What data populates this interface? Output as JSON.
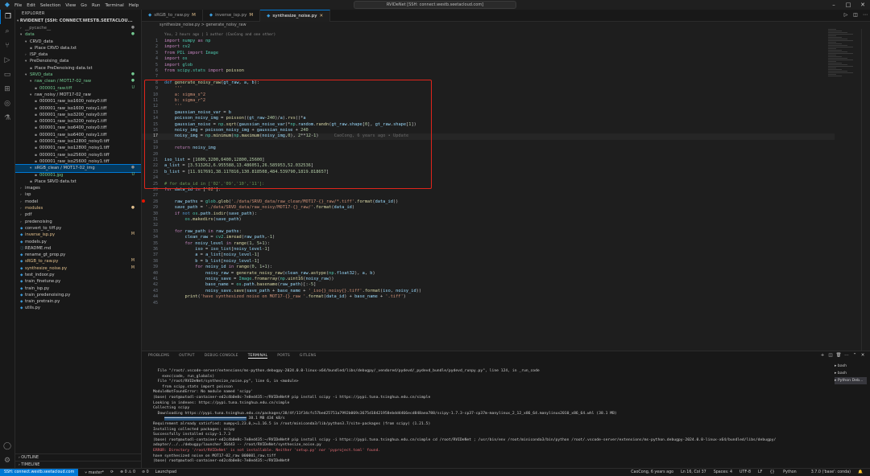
{
  "titlebar": {
    "menu": [
      "File",
      "Edit",
      "Selection",
      "View",
      "Go",
      "Run",
      "Terminal",
      "Help"
    ],
    "search": "RVIDeNet [SSH: connect.westb.seetacloud.com]"
  },
  "sidebar": {
    "header": "EXPLORER",
    "root": "RVIDENET [SSH: CONNECT.WESTB.SEETACLOU...",
    "items": [
      {
        "label": "__pycache__",
        "indent": 1,
        "kind": "folder",
        "open": false,
        "cls": "c-dim",
        "badge": "●"
      },
      {
        "label": "data",
        "indent": 1,
        "kind": "folder",
        "open": true,
        "cls": "c-untracked",
        "badge": "●"
      },
      {
        "label": "CRVD_data",
        "indent": 2,
        "kind": "folder",
        "open": true,
        "cls": "",
        "badge": ""
      },
      {
        "label": "Place CRVD data.txt",
        "indent": 3,
        "kind": "file",
        "cls": "",
        "badge": ""
      },
      {
        "label": "ISP_data",
        "indent": 2,
        "kind": "folder",
        "open": false,
        "cls": "",
        "badge": ""
      },
      {
        "label": "PreDenoising_data",
        "indent": 2,
        "kind": "folder",
        "open": true,
        "cls": "",
        "badge": ""
      },
      {
        "label": "Place PreDenoising data.txt",
        "indent": 3,
        "kind": "file",
        "cls": "",
        "badge": ""
      },
      {
        "label": "SRVD_data",
        "indent": 2,
        "kind": "folder",
        "open": true,
        "cls": "c-untracked",
        "badge": "●"
      },
      {
        "label": "raw_clean / MOT17-02_raw",
        "indent": 3,
        "kind": "folder",
        "open": true,
        "cls": "c-untracked",
        "badge": "●"
      },
      {
        "label": "000001_raw.tiff",
        "indent": 4,
        "kind": "file",
        "cls": "c-untracked",
        "badge": "U"
      },
      {
        "label": "raw_noisy / MOT17-02_raw",
        "indent": 3,
        "kind": "folder",
        "open": true,
        "cls": "",
        "badge": ""
      },
      {
        "label": "000001_raw_iso1600_noisy0.tiff",
        "indent": 4,
        "kind": "file",
        "cls": "",
        "badge": ""
      },
      {
        "label": "000001_raw_iso1600_noisy1.tiff",
        "indent": 4,
        "kind": "file",
        "cls": "",
        "badge": ""
      },
      {
        "label": "000001_raw_iso3200_noisy0.tiff",
        "indent": 4,
        "kind": "file",
        "cls": "",
        "badge": ""
      },
      {
        "label": "000001_raw_iso3200_noisy1.tiff",
        "indent": 4,
        "kind": "file",
        "cls": "",
        "badge": ""
      },
      {
        "label": "000001_raw_iso6400_noisy0.tiff",
        "indent": 4,
        "kind": "file",
        "cls": "",
        "badge": ""
      },
      {
        "label": "000001_raw_iso6400_noisy1.tiff",
        "indent": 4,
        "kind": "file",
        "cls": "",
        "badge": ""
      },
      {
        "label": "000001_raw_iso12800_noisy0.tiff",
        "indent": 4,
        "kind": "file",
        "cls": "",
        "badge": ""
      },
      {
        "label": "000001_raw_iso12800_noisy1.tiff",
        "indent": 4,
        "kind": "file",
        "cls": "",
        "badge": ""
      },
      {
        "label": "000001_raw_iso25600_noisy0.tiff",
        "indent": 4,
        "kind": "file",
        "cls": "",
        "badge": ""
      },
      {
        "label": "000001_raw_iso25600_noisy1.tiff",
        "indent": 4,
        "kind": "file",
        "cls": "",
        "badge": ""
      },
      {
        "label": "sRGB_clean / MOT17-02_img",
        "indent": 3,
        "kind": "folder",
        "open": true,
        "cls": "",
        "badge": "●",
        "sel": true
      },
      {
        "label": "000001.jpg",
        "indent": 4,
        "kind": "file",
        "cls": "c-untracked",
        "badge": "U"
      },
      {
        "label": "Place SRVD data.txt",
        "indent": 3,
        "kind": "file",
        "cls": "",
        "badge": ""
      },
      {
        "label": "images",
        "indent": 1,
        "kind": "folder",
        "open": false,
        "cls": "",
        "badge": ""
      },
      {
        "label": "isp",
        "indent": 1,
        "kind": "folder",
        "open": false,
        "cls": "",
        "badge": ""
      },
      {
        "label": "model",
        "indent": 1,
        "kind": "folder",
        "open": false,
        "cls": "",
        "badge": ""
      },
      {
        "label": "modules",
        "indent": 1,
        "kind": "folder",
        "open": false,
        "cls": "c-mod",
        "badge": "●"
      },
      {
        "label": "pdf",
        "indent": 1,
        "kind": "folder",
        "open": false,
        "cls": "",
        "badge": ""
      },
      {
        "label": "predenoising",
        "indent": 1,
        "kind": "folder",
        "open": false,
        "cls": "",
        "badge": ""
      },
      {
        "label": "convert_to_tiff.py",
        "indent": 1,
        "kind": "py",
        "cls": "",
        "badge": ""
      },
      {
        "label": "inverse_isp.py",
        "indent": 1,
        "kind": "py",
        "cls": "c-mod",
        "badge": "M"
      },
      {
        "label": "models.py",
        "indent": 1,
        "kind": "py",
        "cls": "",
        "badge": ""
      },
      {
        "label": "README.md",
        "indent": 1,
        "kind": "md",
        "cls": "",
        "badge": ""
      },
      {
        "label": "rename_gt_prop.py",
        "indent": 1,
        "kind": "py",
        "cls": "",
        "badge": ""
      },
      {
        "label": "sRGB_to_raw.py",
        "indent": 1,
        "kind": "py",
        "cls": "c-mod",
        "badge": "M"
      },
      {
        "label": "synthesize_noise.py",
        "indent": 1,
        "kind": "py",
        "cls": "c-mod",
        "badge": "M"
      },
      {
        "label": "test_indoor.py",
        "indent": 1,
        "kind": "py",
        "cls": "",
        "badge": ""
      },
      {
        "label": "train_finetune.py",
        "indent": 1,
        "kind": "py",
        "cls": "",
        "badge": ""
      },
      {
        "label": "train_isp.py",
        "indent": 1,
        "kind": "py",
        "cls": "",
        "badge": ""
      },
      {
        "label": "train_predenoising.py",
        "indent": 1,
        "kind": "py",
        "cls": "",
        "badge": ""
      },
      {
        "label": "train_pretrain.py",
        "indent": 1,
        "kind": "py",
        "cls": "",
        "badge": ""
      },
      {
        "label": "utils.py",
        "indent": 1,
        "kind": "py",
        "cls": "",
        "badge": ""
      }
    ],
    "outline": "OUTLINE",
    "timeline": "TIMELINE"
  },
  "tabs": [
    {
      "label": "sRGB_to_raw.py",
      "mod": "M",
      "active": false
    },
    {
      "label": "inverse_isp.py",
      "mod": "M",
      "active": false
    },
    {
      "label": "synthesize_noise.py",
      "mod": "M",
      "active": true
    }
  ],
  "breadcrumb": "synthesize_noise.py  >  generate_noisy_raw",
  "editor": {
    "lens": "You, 2 hours ago | 1 author (CaoCong and one other)",
    "blame": "CaoCong, 6 years ago • Update",
    "lines": [
      {
        "n": "1",
        "html": "<span class=\"kw\">import</span> <span class=\"cls\">numpy</span> <span class=\"kw\">as</span> <span class=\"cls\">np</span>"
      },
      {
        "n": "2",
        "html": "<span class=\"kw\">import</span> <span class=\"cls\">cv2</span>"
      },
      {
        "n": "3",
        "html": "<span class=\"kw\">from</span> <span class=\"cls\">PIL</span> <span class=\"kw\">import</span> <span class=\"cls\">Image</span>"
      },
      {
        "n": "4",
        "html": "<span class=\"kw\">import</span> <span class=\"cls\">os</span>"
      },
      {
        "n": "5",
        "html": "<span class=\"kw\">import</span> <span class=\"cls\">glob</span>"
      },
      {
        "n": "6",
        "html": "<span class=\"kw\">from</span> <span class=\"cls\">scipy.stats</span> <span class=\"kw\">import</span> <span class=\"fn\">poisson</span>"
      },
      {
        "n": "7",
        "html": ""
      },
      {
        "n": "8",
        "html": "<span class=\"kw2\">def</span> <span class=\"fn\">generate_noisy_raw</span>(<span class=\"var\">gt_raw</span>, <span class=\"var\">a</span>, <span class=\"var\">b</span>):"
      },
      {
        "n": "9",
        "html": "    <span class=\"str\">'''</span>"
      },
      {
        "n": "10",
        "html": "<span class=\"str\">    a: sigma_s^2</span>"
      },
      {
        "n": "11",
        "html": "<span class=\"str\">    b: sigma_r^2</span>"
      },
      {
        "n": "12",
        "html": "<span class=\"str\">    '''</span>"
      },
      {
        "n": "13",
        "html": "    <span class=\"var\">gaussian_noise_var</span> = <span class=\"var\">b</span>"
      },
      {
        "n": "14",
        "html": "    <span class=\"var\">poisson_noisy_img</span> = <span class=\"fn\">poisson</span>((<span class=\"var\">gt_raw</span>-<span class=\"num\">240</span>)/<span class=\"var\">a</span>).<span class=\"fn\">rvs</span>()*<span class=\"var\">a</span>"
      },
      {
        "n": "15",
        "html": "    <span class=\"var\">gaussian_noise</span> = <span class=\"cls\">np</span>.<span class=\"fn\">sqrt</span>(<span class=\"var\">gaussian_noise_var</span>)*<span class=\"cls\">np</span>.<span class=\"var\">random</span>.<span class=\"fn\">randn</span>(<span class=\"var\">gt_raw</span>.<span class=\"var\">shape</span>[<span class=\"num\">0</span>], <span class=\"var\">gt_raw</span>.<span class=\"var\">shape</span>[<span class=\"num\">1</span>])"
      },
      {
        "n": "16",
        "html": "    <span class=\"var\">noisy_img</span> = <span class=\"var\">poisson_noisy_img</span> + <span class=\"var\">gaussian_noise</span> + <span class=\"num\">240</span>"
      },
      {
        "n": "17",
        "html": "    <span class=\"var\">noisy_img</span> = <span class=\"cls\">np</span>.<span class=\"fn\">minimum</span>(<span class=\"cls\">np</span>.<span class=\"fn\">maximum</span>(<span class=\"var\">noisy_img</span>,<span class=\"num\">0</span>), <span class=\"num\">2</span>**<span class=\"num\">12</span>-<span class=\"num\">1</span>)",
        "cur": true
      },
      {
        "n": "18",
        "html": ""
      },
      {
        "n": "19",
        "html": "    <span class=\"kw\">return</span> <span class=\"var\">noisy_img</span>"
      },
      {
        "n": "20",
        "html": ""
      },
      {
        "n": "21",
        "html": "<span class=\"var\">iso_list</span> = [<span class=\"num\">1600</span>,<span class=\"num\">3200</span>,<span class=\"num\">6400</span>,<span class=\"num\">12800</span>,<span class=\"num\">25600</span>]"
      },
      {
        "n": "22",
        "html": "<span class=\"var\">a_list</span> = [<span class=\"num\">3.513262</span>,<span class=\"num\">6.955588</span>,<span class=\"num\">13.486051</span>,<span class=\"num\">26.585953</span>,<span class=\"num\">52.032536</span>]"
      },
      {
        "n": "23",
        "html": "<span class=\"var\">b_list</span> = [<span class=\"num\">11.917691</span>,<span class=\"num\">38.117816</span>,<span class=\"num\">130.818508</span>,<span class=\"num\">484.539790</span>,<span class=\"num\">1819.818657</span>]"
      },
      {
        "n": "24",
        "html": ""
      },
      {
        "n": "25",
        "html": "<span class=\"cm\"># for data_id in ['02','09','10','11']:</span>"
      },
      {
        "n": "26",
        "html": "<span class=\"kw\">for</span> <span class=\"var\">data_id</span> <span class=\"kw\">in</span> [<span class=\"str\">'02'</span>]:"
      },
      {
        "n": "27",
        "html": ""
      },
      {
        "n": "28",
        "html": "    <span class=\"var\">raw_paths</span> = <span class=\"cls\">glob</span>.<span class=\"fn\">glob</span>(<span class=\"str\">'./data/SRVD_data/raw_clean/MOT17-{}_raw/*.tiff'</span>.<span class=\"fn\">format</span>(<span class=\"var\">data_id</span>))"
      },
      {
        "n": "29",
        "html": "    <span class=\"var\">save_path</span> = <span class=\"str\">'./data/SRVD_data/raw_noisy/MOT17-{}_raw/'</span>.<span class=\"fn\">format</span>(<span class=\"var\">data_id</span>)"
      },
      {
        "n": "30",
        "html": "    <span class=\"kw\">if</span> <span class=\"kw2\">not</span> <span class=\"cls\">os</span>.<span class=\"var\">path</span>.<span class=\"fn\">isdir</span>(<span class=\"var\">save_path</span>):"
      },
      {
        "n": "31",
        "html": "        <span class=\"cls\">os</span>.<span class=\"fn\">makedirs</span>(<span class=\"var\">save_path</span>)"
      },
      {
        "n": "32",
        "html": ""
      },
      {
        "n": "33",
        "html": "    <span class=\"kw\">for</span> <span class=\"var\">raw_path</span> <span class=\"kw\">in</span> <span class=\"var\">raw_paths</span>:"
      },
      {
        "n": "34",
        "html": "        <span class=\"var\">clean_raw</span> = <span class=\"cls\">cv2</span>.<span class=\"fn\">imread</span>(<span class=\"var\">raw_path</span>,<span class=\"num\">-1</span>)"
      },
      {
        "n": "35",
        "html": "        <span class=\"kw\">for</span> <span class=\"var\">noisy_level</span> <span class=\"kw\">in</span> <span class=\"fn\">range</span>(<span class=\"num\">1</span>, <span class=\"num\">5</span>+<span class=\"num\">1</span>):"
      },
      {
        "n": "36",
        "html": "            <span class=\"var\">iso</span> = <span class=\"var\">iso_list</span>[<span class=\"var\">noisy_level</span>-<span class=\"num\">1</span>]"
      },
      {
        "n": "37",
        "html": "            <span class=\"var\">a</span> = <span class=\"var\">a_list</span>[<span class=\"var\">noisy_level</span>-<span class=\"num\">1</span>]"
      },
      {
        "n": "38",
        "html": "            <span class=\"var\">b</span> = <span class=\"var\">b_list</span>[<span class=\"var\">noisy_level</span>-<span class=\"num\">1</span>]"
      },
      {
        "n": "39",
        "html": "            <span class=\"kw\">for</span> <span class=\"var\">noisy_id</span> <span class=\"kw\">in</span> <span class=\"fn\">range</span>(<span class=\"num\">0</span>, <span class=\"num\">1</span>+<span class=\"num\">1</span>):"
      },
      {
        "n": "40",
        "html": "                <span class=\"var\">noisy_raw</span> = <span class=\"fn\">generate_noisy_raw</span>(<span class=\"var\">clean_raw</span>.<span class=\"fn\">astype</span>(<span class=\"cls\">np</span>.<span class=\"var\">float32</span>), <span class=\"var\">a</span>, <span class=\"var\">b</span>)"
      },
      {
        "n": "41",
        "html": "                <span class=\"var\">noisy_save</span> = <span class=\"cls\">Image</span>.<span class=\"fn\">fromarray</span>(<span class=\"cls\">np</span>.<span class=\"fn\">uint16</span>(<span class=\"var\">noisy_raw</span>))"
      },
      {
        "n": "42",
        "html": "                <span class=\"var\">base_name</span> = <span class=\"cls\">os</span>.<span class=\"var\">path</span>.<span class=\"fn\">basename</span>(<span class=\"var\">raw_path</span>)[:<span class=\"num\">-5</span>]"
      },
      {
        "n": "43",
        "html": "                <span class=\"var\">noisy_save</span>.<span class=\"fn\">save</span>(<span class=\"var\">save_path</span> + <span class=\"var\">base_name</span> + <span class=\"str\">'_iso{}_noisy{}.tiff'</span>.<span class=\"fn\">format</span>(<span class=\"var\">iso</span>, <span class=\"var\">noisy_id</span>))"
      },
      {
        "n": "44",
        "html": "        <span class=\"fn\">print</span>(<span class=\"str\">'have synthesized noise on MOT17-{}_raw '</span>.<span class=\"fn\">format</span>(<span class=\"var\">data_id</span>) + <span class=\"var\">base_name</span> + <span class=\"str\">'.tiff'</span>)"
      },
      {
        "n": "45",
        "html": ""
      }
    ]
  },
  "panel": {
    "tabs": [
      "PROBLEMS",
      "OUTPUT",
      "DEBUG CONSOLE",
      "TERMINAL",
      "PORTS",
      "GITLENS"
    ],
    "active_tab": "TERMINAL",
    "terminals": [
      "bash",
      "bash",
      "Python Deb..."
    ],
    "lines": [
      {
        "t": "  File \"/root/.vscode-server/extensions/ms-python.debugpy-2024.0.0-linux-x64/bundled/libs/debugpy/_vendored/pydevd/_pydevd_bundle/pydevd_runpy.py\", line 124, in _run_code"
      },
      {
        "t": "    exec(code, run_globals)"
      },
      {
        "t": "  File \"/root/RVIDeNet/synthesize_noise.py\", line 6, in <module>"
      },
      {
        "t": "    from scipy.stats import poisson"
      },
      {
        "t": "ModuleNotFoundError: No module named 'scipy'"
      },
      {
        "t": "(base) root@autodl-container-ed2c4b0e8c-7e8ed435:~/RVIDeNet# pip install scipy -i https://pypi.tuna.tsinghua.edu.cn/simple"
      },
      {
        "t": "Looking in indexes: https://pypi.tuna.tsinghua.edu.cn/simple"
      },
      {
        "t": "Collecting scipy"
      },
      {
        "t": "  Downloading https://pypi.tuna.tsinghua.edu.cn/packages/38/4f/11f34cfc57bed25751a7992b069c3675d18421958ebdd4466ecd848aea788/scipy-1.7.3-cp37-cp37m-manylinux_2_12_x86_64.manylinux2010_x86_64.whl (38.1 MB)"
      },
      {
        "t": "     ",
        "sel": "━━━━━━━━━━━━━━━━━━━━━━━━━━━━━━━━━━━━",
        "post": " 38.1 MB 434 kB/s"
      },
      {
        "t": "Requirement already satisfied: numpy<1.23.0,>=1.16.5 in /root/miniconda3/lib/python3.7/site-packages (from scipy) (1.21.5)"
      },
      {
        "t": "Installing collected packages: scipy"
      },
      {
        "t": "Successfully installed scipy-1.7.3"
      },
      {
        "t": "(base) root@autodl-container-ed2c4b0e8c-7e8ed435:~/RVIDeNet# pip install scipy -i https://pypi.tuna.tsinghua.edu.cn/simple cd /root/RVIDeNet ; /usr/bin/env /root/miniconda3/bin/python /root/.vscode-server/extensions/ms-python.debugpy-2024.0.0-linux-x64/bundled/libs/debugpy/"
      },
      {
        "t": "adapter/../../debugpy/launcher 56443 -- /root/RVIDeNet/synthesize_noise.py"
      },
      {
        "t": "ERROR: Directory '/root/RVIDeNet' is not installable. Neither 'setup.py' nor 'pyproject.toml' found.",
        "err": true
      },
      {
        "t": "have synthesized noise on MOT17-02_raw 000001_raw.tiff"
      },
      {
        "t": "(base) root@autodl-container-ed2c4b0e8c-7e8ed435:~/RVIDeNet# "
      }
    ]
  },
  "statusbar": {
    "remote": "SSH: connect.westb.seetacloud.com",
    "branch": "master*",
    "sync": "⟳",
    "problems": "⊗ 0 ⚠ 0",
    "ports": "⊘ 0",
    "launch": "Launchpad",
    "blame": "CaoCong, 6 years ago",
    "position": "Ln 16, Col 37",
    "spaces": "Spaces: 4",
    "encoding": "UTF-8",
    "eol": "LF",
    "language": "Python",
    "interpreter": "3.7.0 ('base': conda)"
  },
  "colors": {
    "accent": "#0078d4",
    "highlight_box": "#e0251b"
  }
}
